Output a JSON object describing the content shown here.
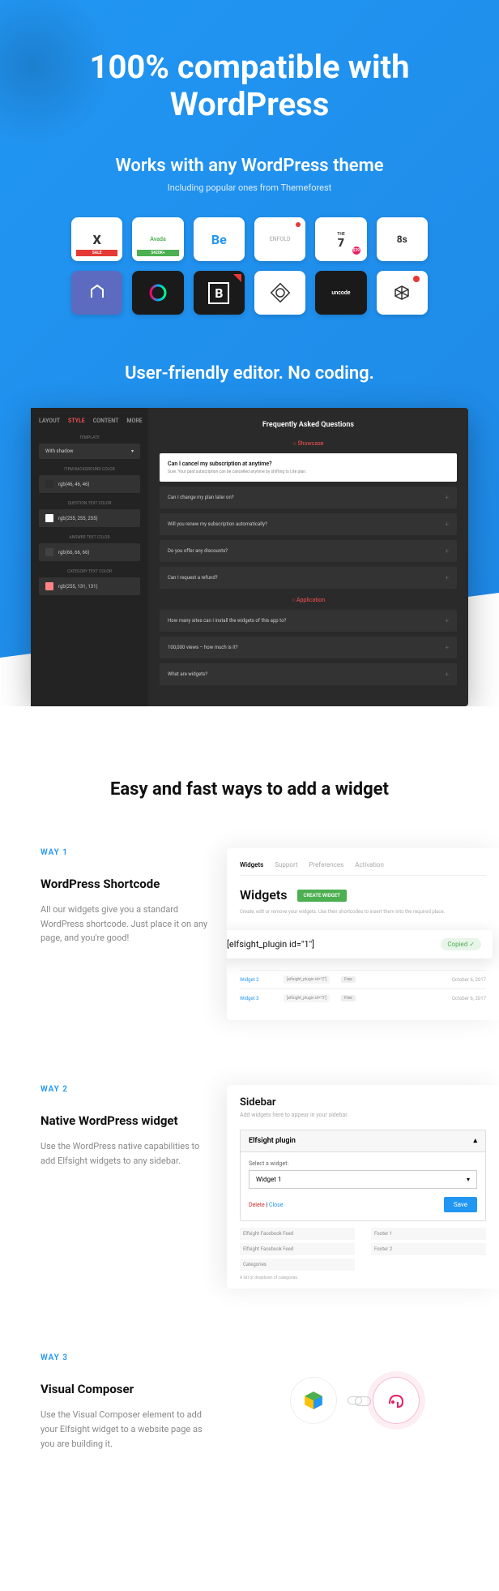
{
  "hero": {
    "title": "100% compatible with WordPress",
    "themes_heading": "Works with any WordPress theme",
    "themes_sub": "Including popular ones from Themeforest",
    "themes": [
      "X",
      "Avada",
      "Be",
      "ENFOLD",
      "THE 7",
      "8s",
      "Crown",
      "Colorful",
      "B",
      "Diamond",
      "uncode",
      "Poly"
    ],
    "editor_heading": "User-friendly editor. No coding."
  },
  "editor": {
    "tabs": [
      "LAYOUT",
      "STYLE",
      "CONTENT",
      "MORE"
    ],
    "active_tab": "STYLE",
    "fields": {
      "template_label": "TEMPLATE",
      "template_value": "With shadow",
      "item_bg_label": "ITEM BACKGROUND COLOR",
      "item_bg_value": "rgb(46, 46, 46)",
      "q_color_label": "QUESTION TEXT COLOR",
      "q_color_value": "rgb(255, 255, 255)",
      "a_color_label": "ANSWER TEXT COLOR",
      "a_color_value": "rgb(66, 66, 66)",
      "cat_color_label": "CATEGORY TEXT COLOR",
      "cat_color_value": "rgb(255, 131, 131)"
    },
    "preview": {
      "title": "Frequently Asked Questions",
      "section1": "Showcase",
      "open_q": "Can I cancel my subscription at anytime?",
      "open_a": "Sure. Your paid subscription can be cancelled anytime by shifting to Lite plan.",
      "items1": [
        "Can I change my plan later on?",
        "Will you renew my subscription automatically?",
        "Do you offer any discounts?",
        "Can I request a refund?"
      ],
      "section2": "Application",
      "items2": [
        "How many sites can I install the widgets of this app to?",
        "100,000 views – how much is it?",
        "What are widgets?"
      ]
    }
  },
  "ways": {
    "heading": "Easy and fast ways to add a widget",
    "way1": {
      "label": "WAY 1",
      "title": "WordPress Shortcode",
      "desc": "All our widgets give you a standard WordPress shortcode. Just place it on any page, and you're good!",
      "panel": {
        "tabs": [
          "Widgets",
          "Support",
          "Preferences",
          "Activation"
        ],
        "h": "Widgets",
        "btn": "CREATE WIDGET",
        "sub": "Create, edit or remove your widgets. Use their shortcodes to insert them into the required place.",
        "code": "[elfsight_plugin id=\"1\"]",
        "copied": "Copied",
        "rows": [
          {
            "name": "Widget 2",
            "sc": "[elfsight_plugin id=\"2\"]",
            "free": "Free",
            "date": "October 6, 2017"
          },
          {
            "name": "Widget 3",
            "sc": "[elfsight_plugin id=\"3\"]",
            "free": "Free",
            "date": "October 6, 2017"
          }
        ]
      }
    },
    "way2": {
      "label": "WAY 2",
      "title": "Native WordPress widget",
      "desc": "Use the WordPress native capabilities to add Elfsight widgets to any sidebar.",
      "panel": {
        "title": "Sidebar",
        "sub": "Add widgets here to appear in your sidebar.",
        "box_title": "Elfsight plugin",
        "select_label": "Select a widget:",
        "select_value": "Widget 1",
        "delete": "Delete",
        "close": "Close",
        "save": "Save",
        "extras_left": [
          "Elfsight Facebook Feed",
          "Elfsight Facebook Feed",
          "Categories"
        ],
        "extras_right": [
          "Footer 1",
          "Footer 2"
        ],
        "note": "A list or dropdown of categories."
      }
    },
    "way3": {
      "label": "WAY 3",
      "title": "Visual Composer",
      "desc": "Use the Visual Composer element to add your Elfsight widget to a  website page as you are building it."
    }
  }
}
